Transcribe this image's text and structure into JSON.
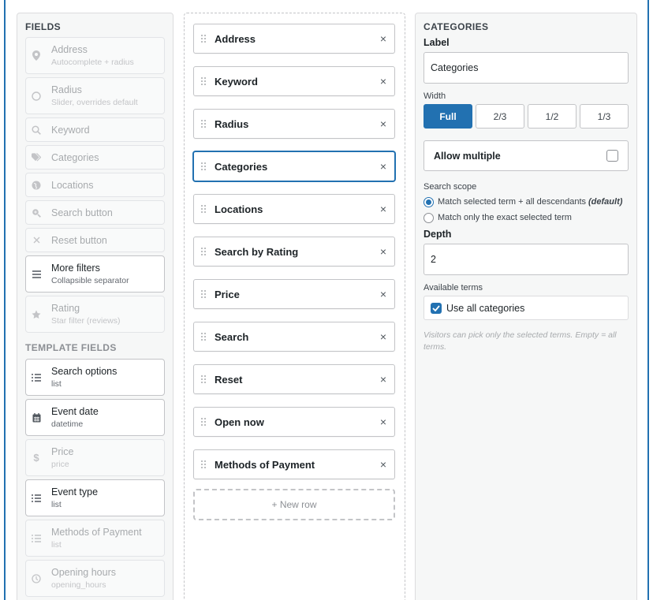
{
  "fields_panel": {
    "title": "FIELDS",
    "items": [
      {
        "label": "Address",
        "sub": "Autocomplete + radius",
        "icon": "map-pin-icon"
      },
      {
        "label": "Radius",
        "sub": "Slider, overrides default",
        "icon": "circle-icon"
      },
      {
        "label": "Keyword",
        "sub": "",
        "icon": "search-icon"
      },
      {
        "label": "Categories",
        "sub": "",
        "icon": "tags-icon"
      },
      {
        "label": "Locations",
        "sub": "",
        "icon": "globe-icon"
      },
      {
        "label": "Search button",
        "sub": "",
        "icon": "zoom-icon"
      },
      {
        "label": "Reset button",
        "sub": "",
        "icon": "close-icon"
      },
      {
        "label": "More filters",
        "sub": "Collapsible separator",
        "icon": "menu-icon"
      },
      {
        "label": "Rating",
        "sub": "Star filter (reviews)",
        "icon": "star-icon"
      }
    ],
    "template_title": "TEMPLATE FIELDS",
    "template_items": [
      {
        "label": "Search options",
        "sub": "list",
        "icon": "list-icon"
      },
      {
        "label": "Event date",
        "sub": "datetime",
        "icon": "calendar-icon"
      },
      {
        "label": "Price",
        "sub": "price",
        "icon": "dollar-icon"
      },
      {
        "label": "Event type",
        "sub": "list",
        "icon": "list-icon"
      },
      {
        "label": "Methods of Payment",
        "sub": "list",
        "icon": "list-icon"
      },
      {
        "label": "Opening hours",
        "sub": "opening_hours",
        "icon": "clock-icon"
      }
    ]
  },
  "rows": {
    "items": [
      {
        "label": "Address"
      },
      {
        "label": "Keyword"
      },
      {
        "label": "Radius"
      },
      {
        "label": "Categories"
      },
      {
        "label": "Locations"
      },
      {
        "label": "Search by Rating"
      },
      {
        "label": "Price"
      },
      {
        "label": "Search"
      },
      {
        "label": "Reset"
      },
      {
        "label": "Open now"
      },
      {
        "label": "Methods of Payment"
      }
    ],
    "remove_glyph": "×",
    "new_row": "+ New row"
  },
  "settings": {
    "title": "CATEGORIES",
    "label_label": "Label",
    "label_value": "Categories",
    "width_label": "Width",
    "width_options": [
      "Full",
      "2/3",
      "1/2",
      "1/3"
    ],
    "width_selected": "Full",
    "allow_multiple": "Allow multiple",
    "allow_multiple_checked": false,
    "scope_label": "Search scope",
    "scope_option_1": "Match selected term + all descendants",
    "scope_option_1_suffix": "(default)",
    "scope_option_2": "Match only the exact selected term",
    "scope_selected": 1,
    "depth_label": "Depth",
    "depth_value": "2",
    "terms_label": "Available terms",
    "use_all": "Use all categories",
    "use_all_checked": true,
    "help": "Visitors can pick only the selected terms. Empty = all terms."
  },
  "colors": {
    "accent": "#2271b1",
    "border": "#c3c4c7",
    "panel": "#f6f7f7"
  }
}
